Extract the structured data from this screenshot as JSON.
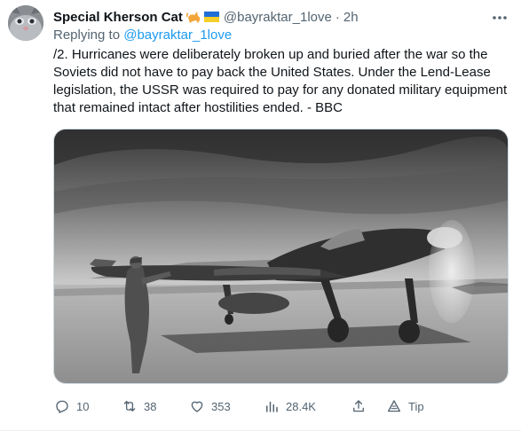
{
  "tweet": {
    "author_name": "Special Kherson Cat",
    "author_emojis": "🐈🇺🇦",
    "handle": "@bayraktar_1love",
    "separator": "·",
    "time": "2h",
    "replying_prefix": "Replying to",
    "replying_handle": "@bayraktar_1love",
    "text": "/2. Hurricanes were deliberately broken up and buried after the war so the Soviets did not have to pay back the United States. Under the Lend-Lease legislation, the USSR was required to pay for any donated military equipment that remained intact after hostilities ended. - BBC",
    "image": {
      "description_icon": "photo"
    }
  },
  "actions": {
    "replies": "10",
    "retweets": "38",
    "likes": "353",
    "views": "28.4K",
    "tip_label": "Tip"
  },
  "colors": {
    "text": "#0f1419",
    "secondary": "#536471",
    "link": "#1d9bf0",
    "divider": "#eff3f4"
  }
}
